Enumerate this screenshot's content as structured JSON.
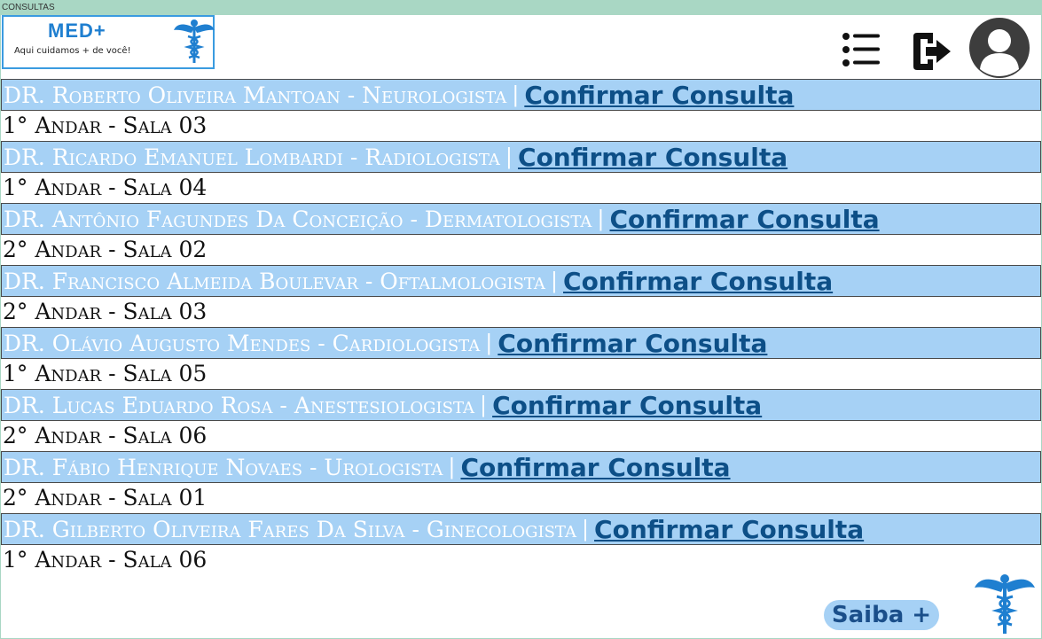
{
  "window": {
    "tab_title": "CONSULTAS"
  },
  "logo": {
    "title": "MED+",
    "subtitle": "Aqui cuidamos + de você!",
    "icon": "caduceus-icon"
  },
  "header": {
    "menu_icon": "menu-list-icon",
    "logout_icon": "logout-icon",
    "avatar_icon": "user-avatar-icon"
  },
  "doctors": [
    {
      "name": "DR. Roberto Oliveira Mantoan - Neurologista",
      "sep": "|",
      "action": "Confirmar Consulta",
      "room": "1° Andar - Sala 03"
    },
    {
      "name": "DR. Ricardo Emanuel Lombardi - Radiologista",
      "sep": "|",
      "action": "Confirmar Consulta",
      "room": "1° Andar - Sala 04"
    },
    {
      "name": "DR. Antônio Fagundes Da Conceição - Dermatologista",
      "sep": "|",
      "action": "Confirmar Consulta",
      "room": "2° Andar - Sala 02"
    },
    {
      "name": "DR. Francisco Almeida Boulevar - Oftalmologista",
      "sep": "|",
      "action": "Confirmar Consulta",
      "room": "2° Andar - Sala 03"
    },
    {
      "name": "DR. Olávio Augusto Mendes - Cardiologista",
      "sep": "|",
      "action": "Confirmar Consulta",
      "room": "1° Andar - Sala 05"
    },
    {
      "name": "DR. Lucas Eduardo Rosa - Anestesiologista",
      "sep": "|",
      "action": "Confirmar Consulta",
      "room": "2° Andar - Sala 06"
    },
    {
      "name": "DR. Fábio Henrique Novaes - Urologista",
      "sep": "|",
      "action": "Confirmar Consulta",
      "room": "2° Andar - Sala 01"
    },
    {
      "name": "DR. Gilberto Oliveira Fares Da Silva - Ginecologista",
      "sep": "|",
      "action": "Confirmar Consulta",
      "room": "1° Andar - Sala 06"
    }
  ],
  "footer": {
    "saiba_label": "Saiba +",
    "icon": "caduceus-icon"
  },
  "colors": {
    "bar": "#a6d1f5",
    "link": "#0d4f87",
    "brand": "#1f7fd0",
    "background": "#a9d7c4"
  }
}
